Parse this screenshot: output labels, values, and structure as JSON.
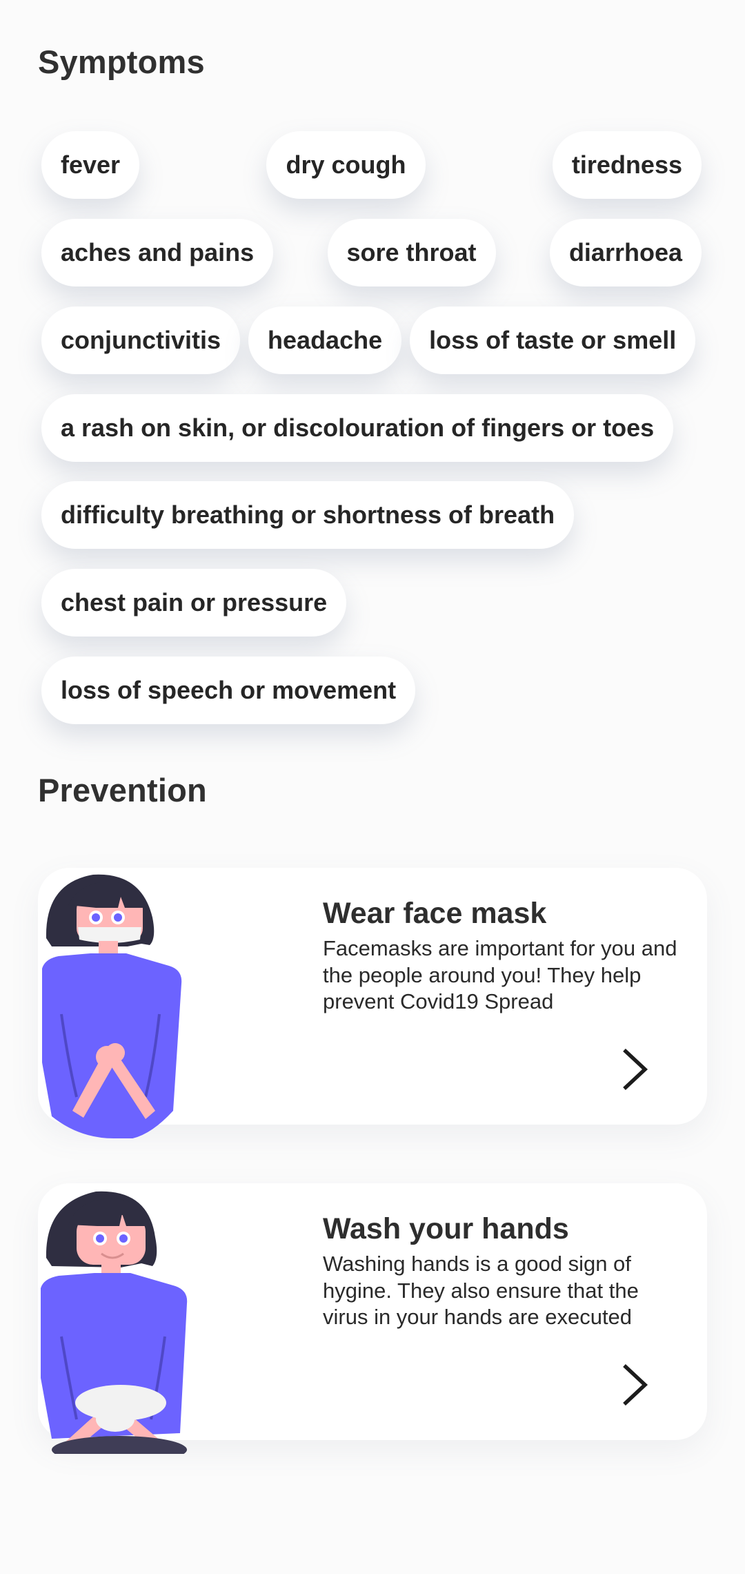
{
  "symptoms": {
    "title": "Symptoms",
    "rows": [
      [
        "fever",
        "dry cough",
        "tiredness"
      ],
      [
        "aches and pains",
        "sore throat",
        "diarrhoea"
      ],
      [
        "conjunctivitis",
        "headache",
        "loss of taste or smell"
      ],
      [
        "a rash on skin, or discolouration of fingers or toes"
      ],
      [
        "difficulty breathing or shortness of breath"
      ],
      [
        "chest pain or pressure"
      ],
      [
        "loss of speech or movement"
      ]
    ]
  },
  "prevention": {
    "title": "Prevention",
    "cards": [
      {
        "title": "Wear face mask",
        "description": "Facemasks are important for you and the people around you! They help prevent Covid19 Spread",
        "illustration": "woman-wearing-mask-illustration",
        "action_icon": "chevron-right-icon"
      },
      {
        "title": "Wash your hands",
        "description": "Washing hands is a good sign of hygine. They also ensure that the virus in your hands are executed",
        "illustration": "woman-washing-hands-illustration",
        "action_icon": "chevron-right-icon"
      }
    ]
  },
  "colors": {
    "background": "#fbfbfb",
    "chip_background": "#ffffff",
    "text": "#2b2b2b",
    "illustration_purple": "#6c63ff",
    "illustration_skin": "#ffb6b6",
    "illustration_hair": "#2f2e41"
  }
}
